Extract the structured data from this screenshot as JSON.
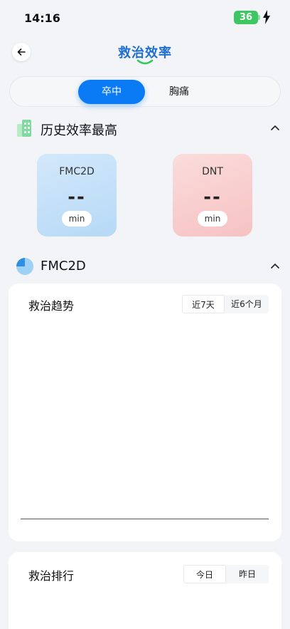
{
  "status_bar": {
    "time": "14:16",
    "battery": "36"
  },
  "nav": {
    "title": "救治效率"
  },
  "segment": {
    "tabs": [
      "卒中",
      "胸痛"
    ],
    "selected": 0
  },
  "history_section": {
    "title": "历史效率最高",
    "cards": [
      {
        "name": "FMC2D",
        "value": "--",
        "unit": "min",
        "color": "#bcdcf7"
      },
      {
        "name": "DNT",
        "value": "--",
        "unit": "min",
        "color": "#f8c9c9"
      }
    ]
  },
  "fmc_section": {
    "title": "FMC2D"
  },
  "trend_panel": {
    "title": "救治趋势",
    "tabs": [
      "近7天",
      "近6个月"
    ]
  },
  "ranking_panel": {
    "title": "救治排行",
    "tabs": [
      "今日",
      "昨日"
    ]
  },
  "colors": {
    "accent": "#0a7bf5",
    "title_blue": "#1e6fd0",
    "battery": "#3cc763"
  }
}
